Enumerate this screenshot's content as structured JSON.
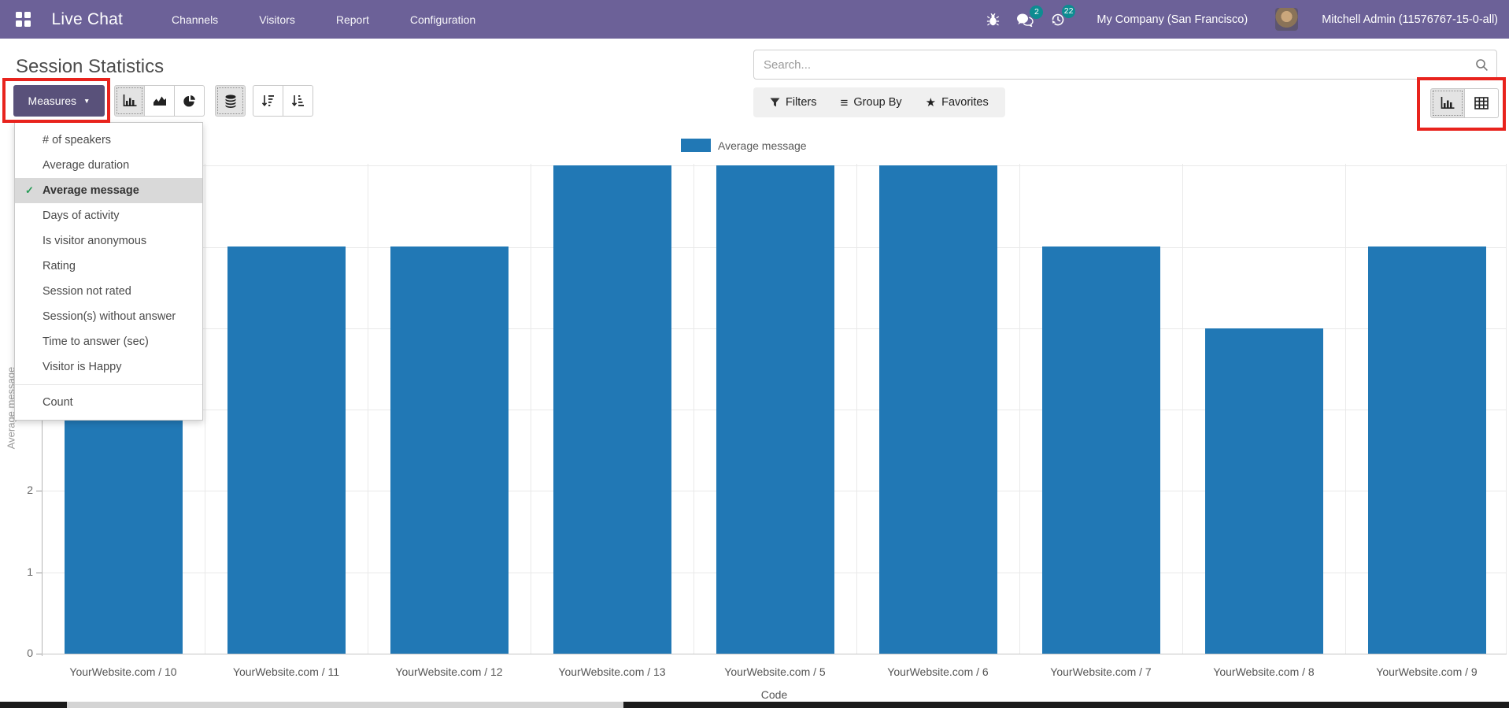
{
  "nav": {
    "brand": "Live Chat",
    "menus": [
      "Channels",
      "Visitors",
      "Report",
      "Configuration"
    ],
    "systray": {
      "messages_badge": "2",
      "activities_badge": "22",
      "company": "My Company (San Francisco)",
      "user": "Mitchell Admin (11576767-15-0-all)"
    }
  },
  "page": {
    "title": "Session Statistics"
  },
  "search": {
    "placeholder": "Search..."
  },
  "filter_bar": {
    "filters": "Filters",
    "group_by": "Group By",
    "favorites": "Favorites"
  },
  "measures": {
    "button": "Measures",
    "selected": "Average message",
    "items": [
      "# of speakers",
      "Average duration",
      "Average message",
      "Days of activity",
      "Is visitor anonymous",
      "Rating",
      "Session not rated",
      "Session(s) without answer",
      "Time to answer (sec)",
      "Visitor is Happy"
    ],
    "count_item": "Count"
  },
  "chart_data": {
    "type": "bar",
    "categories": [
      "YourWebsite.com / 10",
      "YourWebsite.com / 11",
      "YourWebsite.com / 12",
      "YourWebsite.com / 13",
      "YourWebsite.com / 5",
      "YourWebsite.com / 6",
      "YourWebsite.com / 7",
      "YourWebsite.com / 8",
      "YourWebsite.com / 9"
    ],
    "series": [
      {
        "name": "Average message",
        "values": [
          2.9,
          5,
          5,
          6,
          6,
          6,
          5,
          4,
          5
        ]
      }
    ],
    "xlabel": "Code",
    "ylabel": "Average message",
    "ylim": [
      0,
      6
    ],
    "yticks_visible": [
      0,
      1,
      2
    ],
    "grid": true,
    "legend": {
      "label": "Average message",
      "position": "top"
    },
    "bar_color": "#2178b5"
  },
  "glyphs": {
    "caret_down": "▼",
    "star": "★",
    "hamburger": "≡",
    "check": "✓"
  },
  "colors": {
    "navbar": "#6c6198",
    "primary_button": "#59517a",
    "bar": "#2178b5",
    "badge": "#0d8c91",
    "annotation": "#e8231d"
  }
}
